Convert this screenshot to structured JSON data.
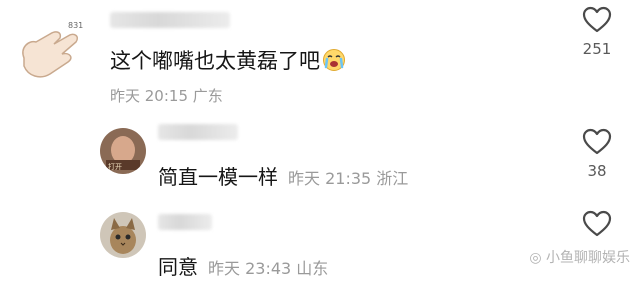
{
  "comments": [
    {
      "text": "这个嘟嘴也太黄磊了吧",
      "meta": "昨天 20:15 广东",
      "likes": "251",
      "avatar_icon": "hand-gesture-avatar",
      "emoji_icon": "crying-face-emoji"
    }
  ],
  "replies": [
    {
      "text": "简直一模一样",
      "meta": "昨天 21:35 浙江",
      "likes": "38",
      "avatar_icon": "photo-avatar"
    },
    {
      "text": "同意",
      "meta": "昨天 23:43 山东",
      "likes": "",
      "avatar_icon": "cat-avatar"
    }
  ],
  "watermark": "小鱼聊聊娱乐",
  "colors": {
    "text": "#161616",
    "meta": "#9a9a9a",
    "icon": "#4a4a4a"
  }
}
